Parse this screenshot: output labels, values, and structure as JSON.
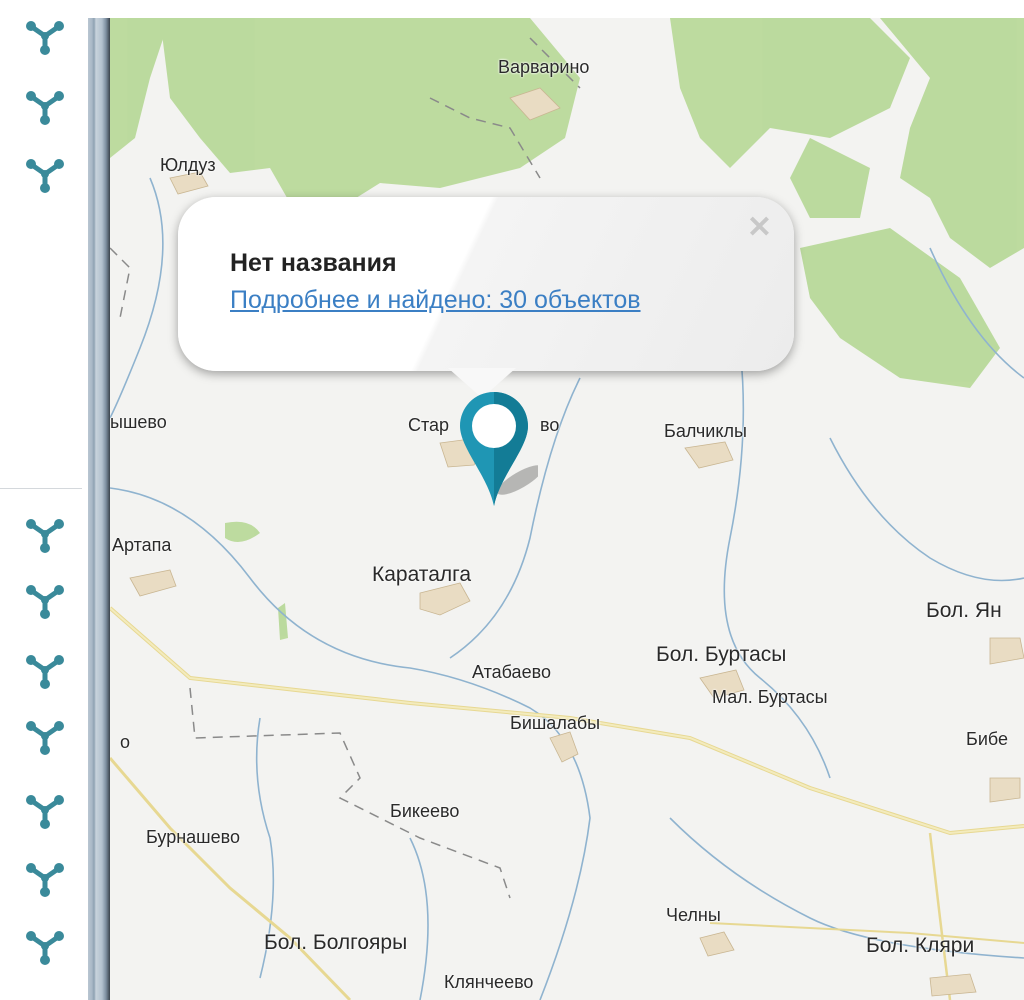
{
  "balloon": {
    "title": "Нет названия",
    "link_text": "Подробнее и найдено: 30 объектов",
    "close_icon": "close-icon"
  },
  "sidebar": {
    "icon": "share-node-icon",
    "icon_color": "#3a8a9a"
  },
  "marker": {
    "icon": "map-pin-icon",
    "color": "#1f96b4"
  },
  "map": {
    "places": [
      {
        "id": "varvarino",
        "label": "Варварино"
      },
      {
        "id": "yulduz",
        "label": "Юлдуз"
      },
      {
        "id": "yshevo",
        "label": "ышево"
      },
      {
        "id": "star",
        "label": "Стар"
      },
      {
        "id": "vo",
        "label": "во"
      },
      {
        "id": "balchikly",
        "label": "Балчиклы"
      },
      {
        "id": "artapa",
        "label": "Артапа"
      },
      {
        "id": "karatalga",
        "label": "Караталга"
      },
      {
        "id": "bol-yan",
        "label": "Бол. Ян"
      },
      {
        "id": "atabaevo",
        "label": "Атабаево"
      },
      {
        "id": "bol-burtasy",
        "label": "Бол. Буртасы"
      },
      {
        "id": "mal-burtasy",
        "label": "Мал. Буртасы"
      },
      {
        "id": "bishalaby",
        "label": "Бишалабы"
      },
      {
        "id": "o",
        "label": "о"
      },
      {
        "id": "bibe",
        "label": "Бибе"
      },
      {
        "id": "bikeevo",
        "label": "Бикеево"
      },
      {
        "id": "burnashevo",
        "label": "Бурнашево"
      },
      {
        "id": "chelny",
        "label": "Челны"
      },
      {
        "id": "bol-bolgoyary",
        "label": "Бол. Болгояры"
      },
      {
        "id": "bol-klyari",
        "label": "Бол. Кляри"
      },
      {
        "id": "klyancheevo",
        "label": "Клянчеево"
      }
    ]
  }
}
